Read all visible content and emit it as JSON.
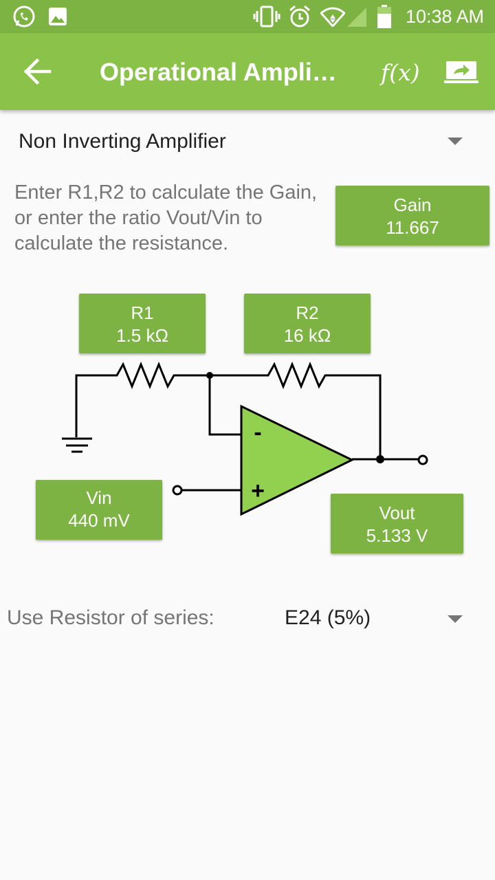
{
  "status_bar": {
    "time": "10:38 AM"
  },
  "app_bar": {
    "title": "Operational Ampli…",
    "formula_label": "f(x)"
  },
  "amplifier_type": {
    "selected": "Non Inverting Amplifier"
  },
  "instructions": "Enter R1,R2 to calculate the Gain, or enter the ratio Vout/Vin to calculate the resistance.",
  "gain": {
    "label": "Gain",
    "value": "11.667"
  },
  "r1": {
    "label": "R1",
    "value": "1.5 kΩ"
  },
  "r2": {
    "label": "R2",
    "value": "16 kΩ"
  },
  "vin": {
    "label": "Vin",
    "value": "440 mV"
  },
  "vout": {
    "label": "Vout",
    "value": "5.133 V"
  },
  "opamp": {
    "minus_label": "-",
    "plus_label": "+"
  },
  "resistor_series": {
    "label": "Use Resistor of series:",
    "selected": "E24 (5%)"
  },
  "colors": {
    "primary": "#8bc34a",
    "primary_dark": "#7cb342",
    "opamp_fill": "#92d050"
  }
}
